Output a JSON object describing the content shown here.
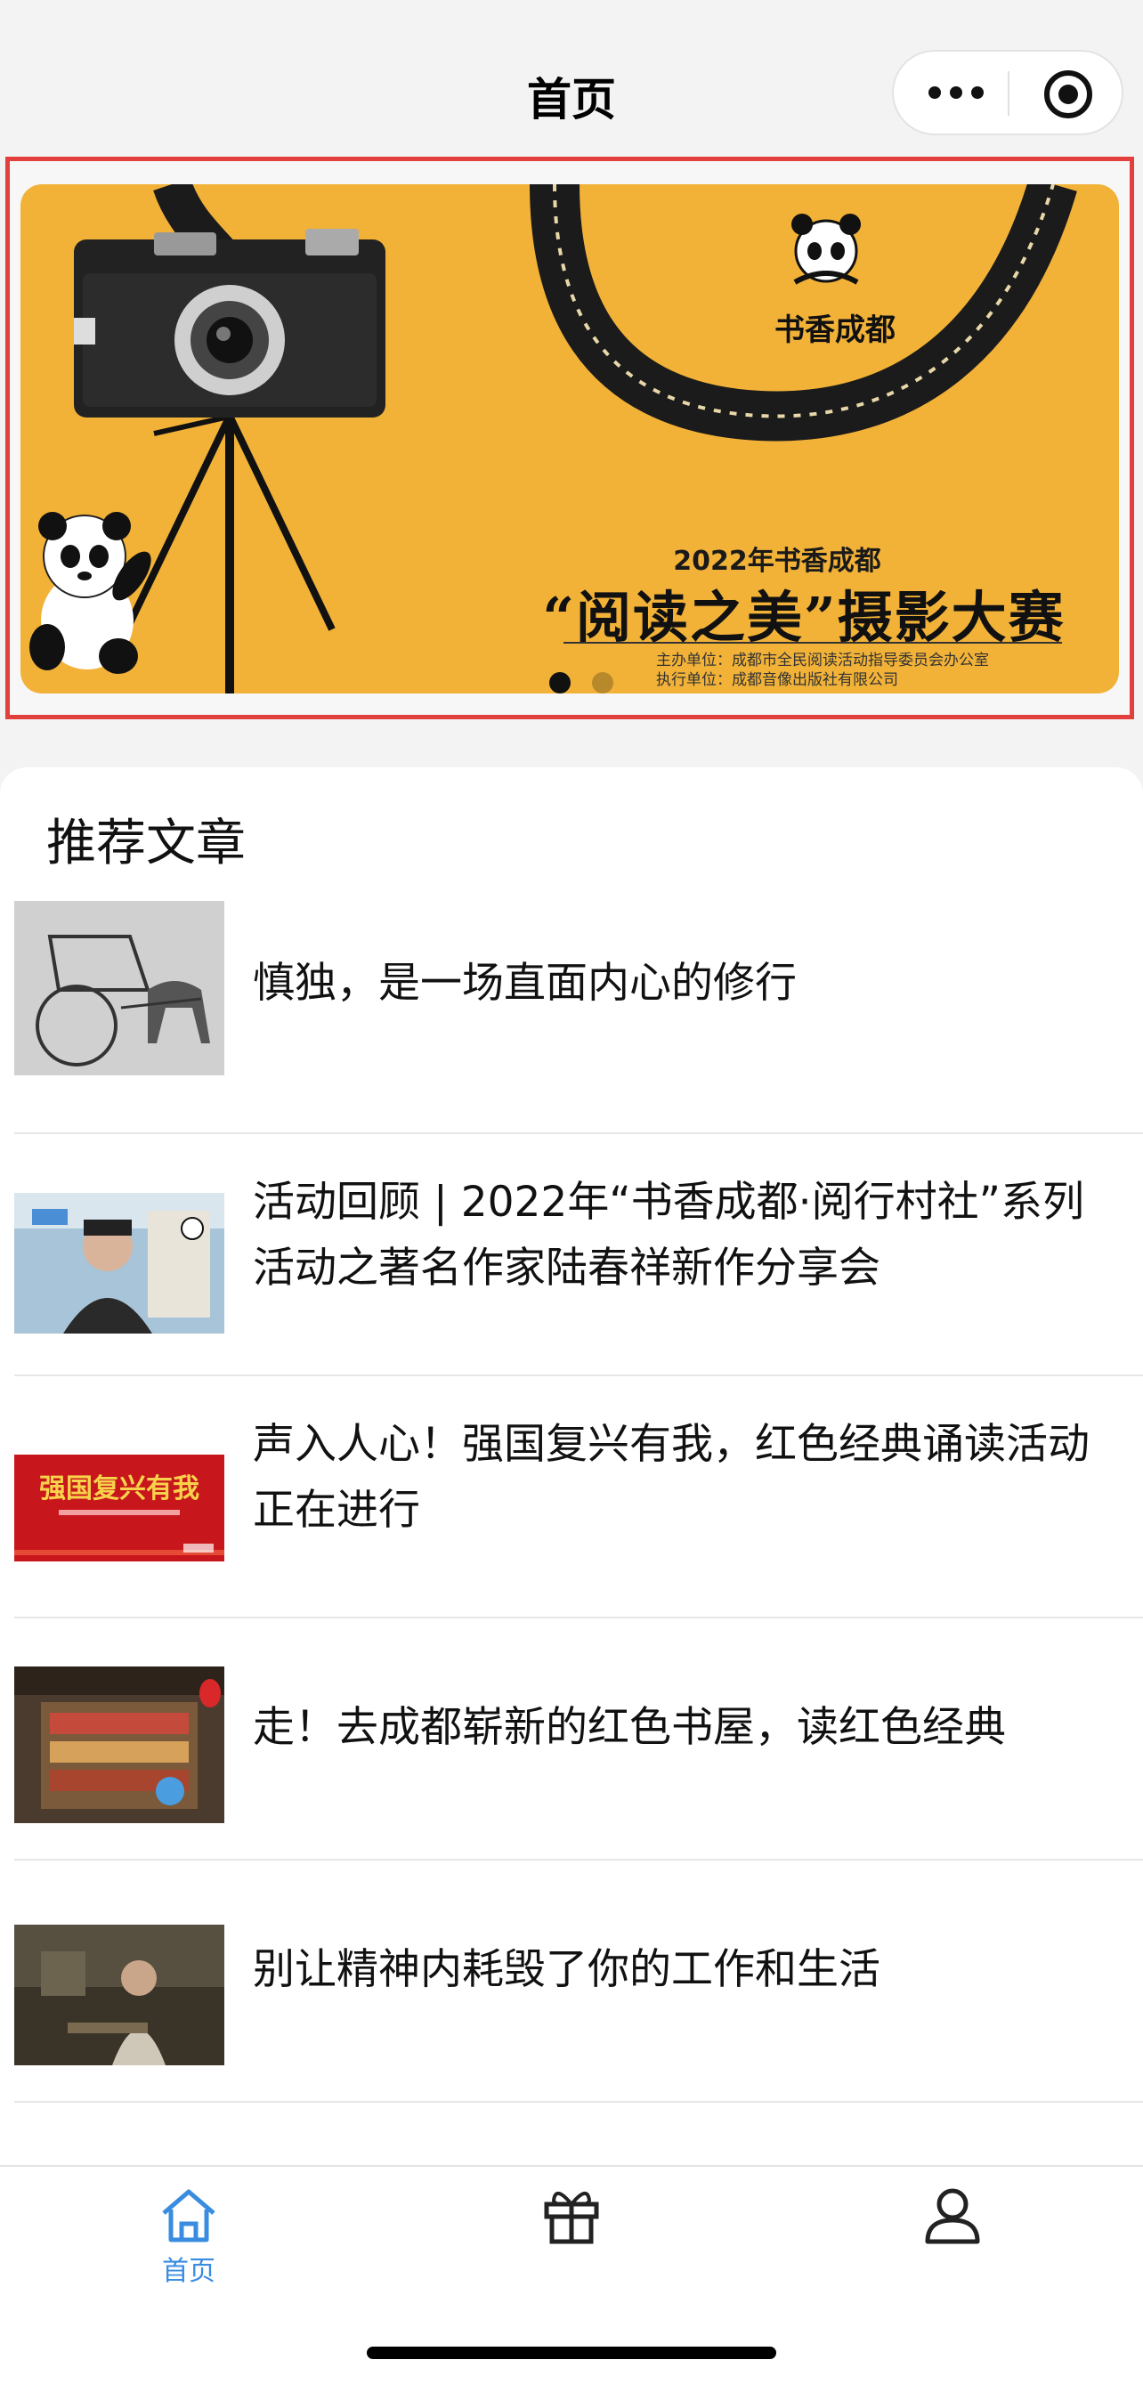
{
  "navbar": {
    "title": "首页",
    "more_icon": "more-dots-icon",
    "close_icon": "target-close-icon"
  },
  "banner": {
    "brand_name": "书香成都",
    "heading": "2022年书香成都",
    "main_title": "“阅读之美”摄影大赛",
    "organizer": "主办单位：成都市全民阅读活动指导委员会办公室",
    "executor": "执行单位：成都音像出版社有限公司",
    "slides_total": 2,
    "active_slide": 1,
    "background_color": "#f2b238"
  },
  "section": {
    "title": "推荐文章"
  },
  "articles": [
    {
      "title": "慎独，是一场直面内心的修行"
    },
    {
      "title": "活动回顾 | 2022年“书香成都·阅行村社”系列活动之著名作家陆春祥新作分享会"
    },
    {
      "title": "声入人心！强国复兴有我，红色经典诵读活动正在进行",
      "thumb_text": "强国复兴有我"
    },
    {
      "title": "走！去成都崭新的红色书屋，读红色经典"
    },
    {
      "title": "别让精神内耗毁了你的工作和生活"
    }
  ],
  "tabbar": {
    "items": [
      {
        "label": "首页",
        "icon": "home-icon",
        "active": true
      },
      {
        "label": "",
        "icon": "gift-icon",
        "active": false
      },
      {
        "label": "",
        "icon": "user-icon",
        "active": false
      }
    ],
    "active_color": "#3a8ce0"
  }
}
